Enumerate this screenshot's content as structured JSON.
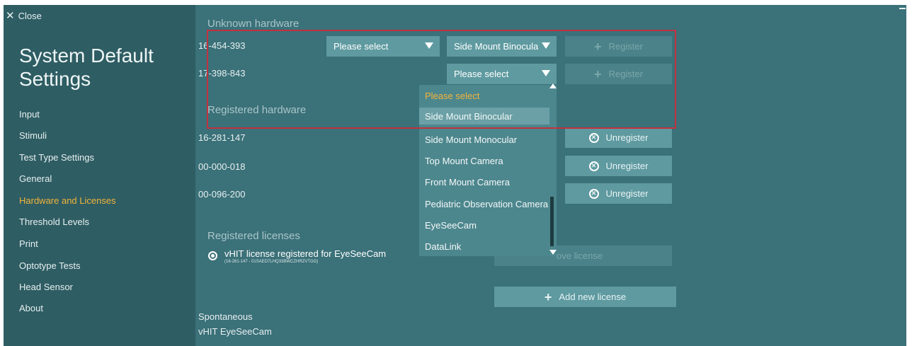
{
  "close_label": "Close",
  "title": "System Default Settings",
  "nav": [
    {
      "label": "Input"
    },
    {
      "label": "Stimuli"
    },
    {
      "label": "Test Type Settings"
    },
    {
      "label": "General"
    },
    {
      "label": "Hardware and Licenses",
      "active": true
    },
    {
      "label": "Threshold Levels"
    },
    {
      "label": "Print"
    },
    {
      "label": "Optotype Tests"
    },
    {
      "label": "Head Sensor"
    },
    {
      "label": "About"
    }
  ],
  "unknown_hardware": {
    "heading": "Unknown hardware",
    "rows": [
      {
        "serial": "16-454-393",
        "type_select": "Please select",
        "mount_select": "Side Mount Binocula",
        "register_label": "Register"
      },
      {
        "serial": "17-398-843",
        "mount_select": "Please select",
        "register_label": "Register"
      }
    ]
  },
  "registered_hardware": {
    "heading": "Registered hardware",
    "rows": [
      {
        "serial": "16-281-147",
        "unregister_label": "Unregister"
      },
      {
        "serial": "00-000-018",
        "unregister_label": "Unregister"
      },
      {
        "serial": "00-096-200",
        "unregister_label": "Unregister"
      }
    ]
  },
  "dropdown": {
    "items": [
      "Please select",
      "Side Mount Binocular",
      "Side Mount Monocular",
      "Top Mount Camera",
      "Front Mount Camera",
      "Pediatric Observation Camera",
      "EyeSeeCam",
      "DataLink"
    ],
    "hovered_index": 1
  },
  "registered_licenses": {
    "heading": "Registered licenses",
    "license_name": "vHIT license registered for EyeSeeCam",
    "license_key": "(16-281-147 - 01SAED7LHQ33BWCZHRZVTGG)",
    "remove_label_visible": "ove license",
    "add_label": "Add new license"
  },
  "footer_lines": [
    "Spontaneous",
    "vHIT EyeSeeCam"
  ],
  "colors": {
    "sidebar": "#2e5d63",
    "main": "#3b7179",
    "accent": "#f2b43a",
    "highlight": "#c1313f"
  }
}
